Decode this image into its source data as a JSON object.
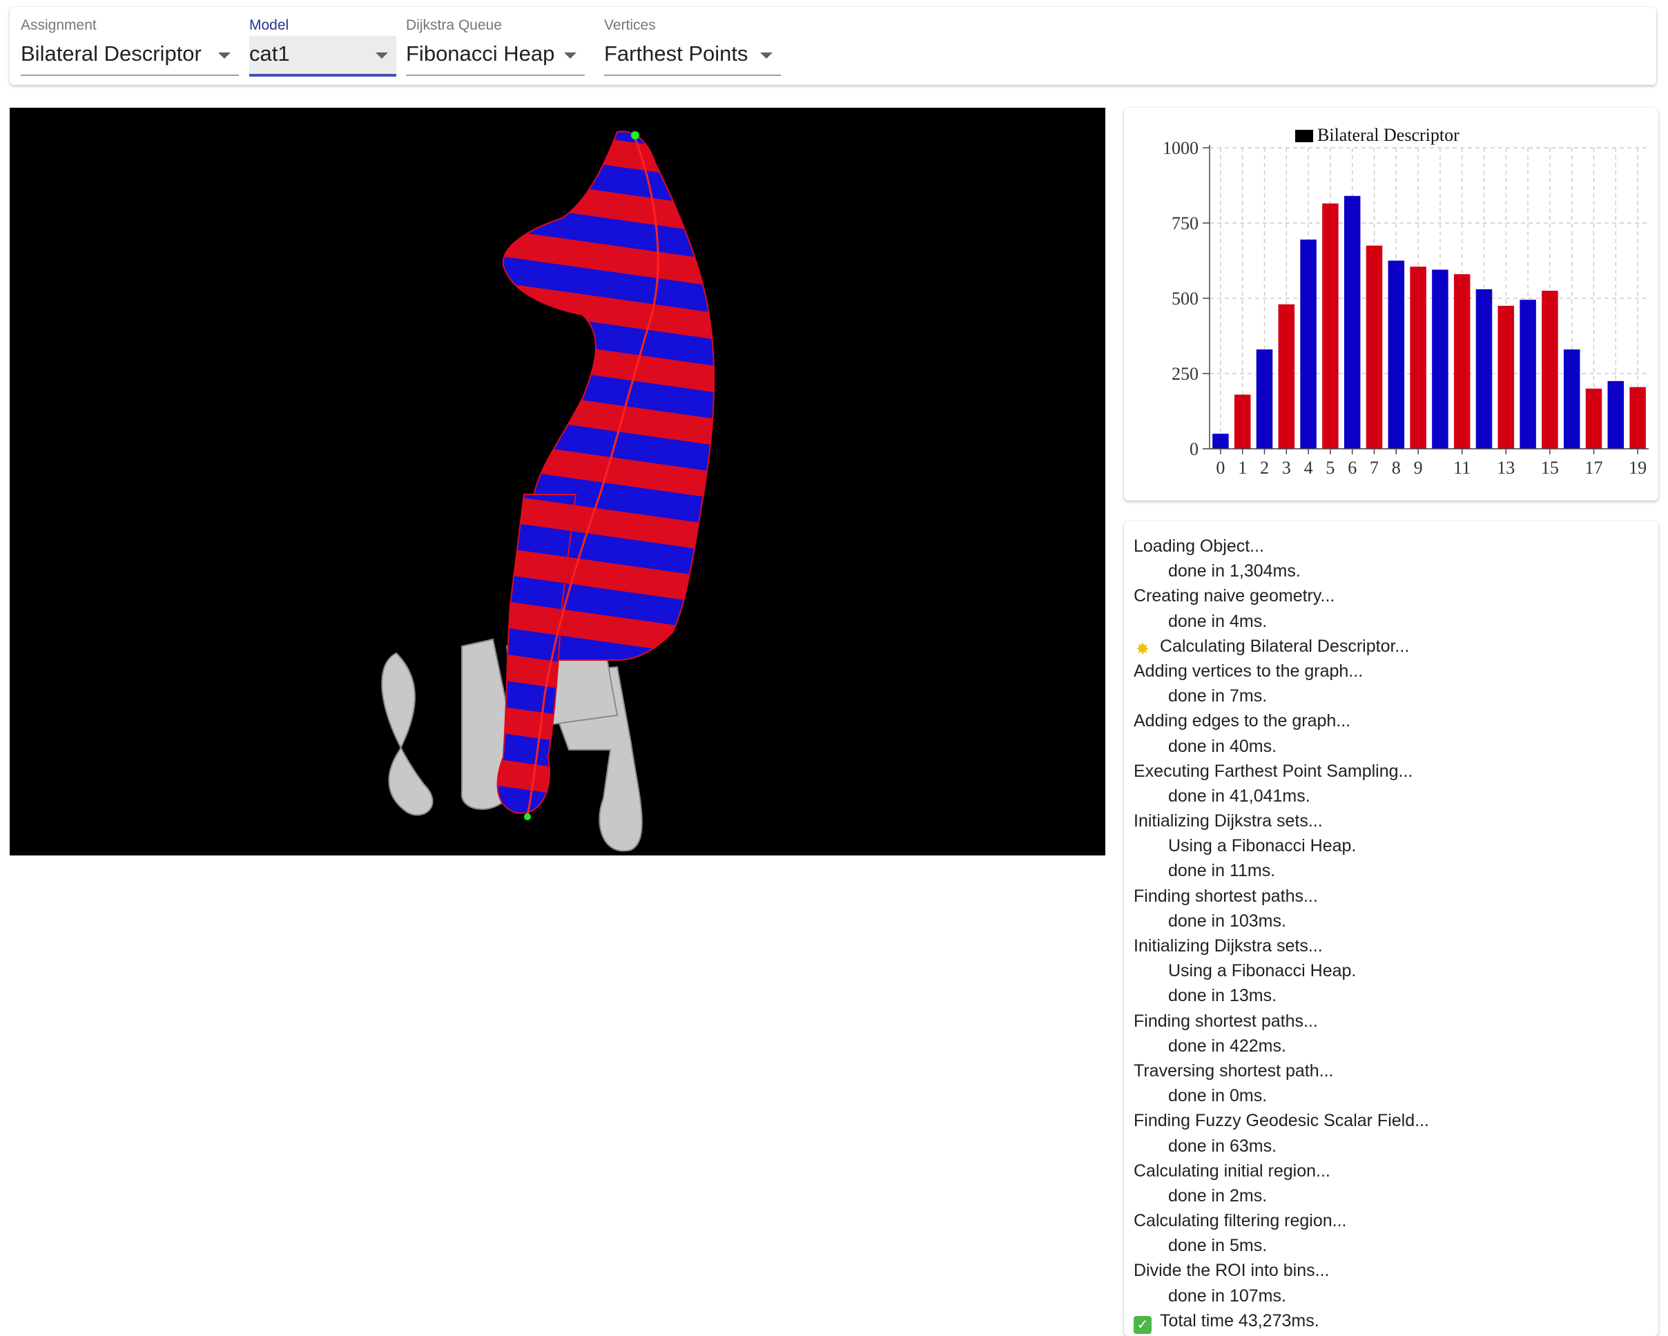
{
  "toolbar": {
    "assignment": {
      "label": "Assignment",
      "value": "Bilateral Descriptor"
    },
    "model": {
      "label": "Model",
      "value": "cat1"
    },
    "queue": {
      "label": "Dijkstra Queue",
      "value": "Fibonacci Heap"
    },
    "vertices": {
      "label": "Vertices",
      "value": "Farthest Points"
    }
  },
  "viewport": {
    "background": "#000000",
    "stripe_colors": [
      "#dd0b1e",
      "#1410d8"
    ],
    "base_color": "#c8c8c8",
    "path_color": "#ff2020",
    "endpoint_color": "#22ee22"
  },
  "chart_data": {
    "type": "bar",
    "title": "",
    "legend": [
      "Bilateral Descriptor"
    ],
    "legend_placement": "top",
    "categories": [
      0,
      1,
      2,
      3,
      4,
      5,
      6,
      7,
      8,
      9,
      10,
      11,
      12,
      13,
      14,
      15,
      16,
      17,
      18,
      19
    ],
    "tick_labels": [
      "0",
      "1",
      "2",
      "3",
      "4",
      "5",
      "6",
      "7",
      "8",
      "9",
      "11",
      "13",
      "15",
      "17",
      "19"
    ],
    "values": [
      50,
      180,
      330,
      480,
      695,
      815,
      840,
      675,
      625,
      605,
      595,
      580,
      530,
      475,
      495,
      525,
      330,
      200,
      225,
      205
    ],
    "colors": [
      "#0a00c8",
      "#d40012"
    ],
    "ylim": [
      0,
      1000
    ],
    "yticks": [
      "0",
      "250",
      "500",
      "750",
      "1000"
    ],
    "grid": true,
    "xlabel": "",
    "ylabel": ""
  },
  "log": [
    {
      "text": "Loading Object...",
      "indent": false,
      "icon": null
    },
    {
      "text": "done in 1,304ms.",
      "indent": true,
      "icon": null
    },
    {
      "text": "Creating naive geometry...",
      "indent": false,
      "icon": null
    },
    {
      "text": "done in 4ms.",
      "indent": true,
      "icon": null
    },
    {
      "text": "Calculating Bilateral Descriptor...",
      "indent": false,
      "icon": "sparkle-icon"
    },
    {
      "text": "Adding vertices to the graph...",
      "indent": false,
      "icon": null
    },
    {
      "text": "done in 7ms.",
      "indent": true,
      "icon": null
    },
    {
      "text": "Adding edges to the graph...",
      "indent": false,
      "icon": null
    },
    {
      "text": "done in 40ms.",
      "indent": true,
      "icon": null
    },
    {
      "text": "Executing Farthest Point Sampling...",
      "indent": false,
      "icon": null
    },
    {
      "text": "done in 41,041ms.",
      "indent": true,
      "icon": null
    },
    {
      "text": "Initializing Dijkstra sets...",
      "indent": false,
      "icon": null
    },
    {
      "text": "Using a Fibonacci Heap.",
      "indent": true,
      "icon": null
    },
    {
      "text": "done in 11ms.",
      "indent": true,
      "icon": null
    },
    {
      "text": "Finding shortest paths...",
      "indent": false,
      "icon": null
    },
    {
      "text": "done in 103ms.",
      "indent": true,
      "icon": null
    },
    {
      "text": "Initializing Dijkstra sets...",
      "indent": false,
      "icon": null
    },
    {
      "text": "Using a Fibonacci Heap.",
      "indent": true,
      "icon": null
    },
    {
      "text": "done in 13ms.",
      "indent": true,
      "icon": null
    },
    {
      "text": "Finding shortest paths...",
      "indent": false,
      "icon": null
    },
    {
      "text": "done in 422ms.",
      "indent": true,
      "icon": null
    },
    {
      "text": "Traversing shortest path...",
      "indent": false,
      "icon": null
    },
    {
      "text": "done in 0ms.",
      "indent": true,
      "icon": null
    },
    {
      "text": "Finding Fuzzy Geodesic Scalar Field...",
      "indent": false,
      "icon": null
    },
    {
      "text": "done in 63ms.",
      "indent": true,
      "icon": null
    },
    {
      "text": "Calculating initial region...",
      "indent": false,
      "icon": null
    },
    {
      "text": "done in 2ms.",
      "indent": true,
      "icon": null
    },
    {
      "text": "Calculating filtering region...",
      "indent": false,
      "icon": null
    },
    {
      "text": "done in 5ms.",
      "indent": true,
      "icon": null
    },
    {
      "text": "Divide the ROI into bins...",
      "indent": false,
      "icon": null
    },
    {
      "text": "done in 107ms.",
      "indent": true,
      "icon": null
    },
    {
      "text": "Total time 43,273ms.",
      "indent": false,
      "icon": "check-icon"
    }
  ]
}
